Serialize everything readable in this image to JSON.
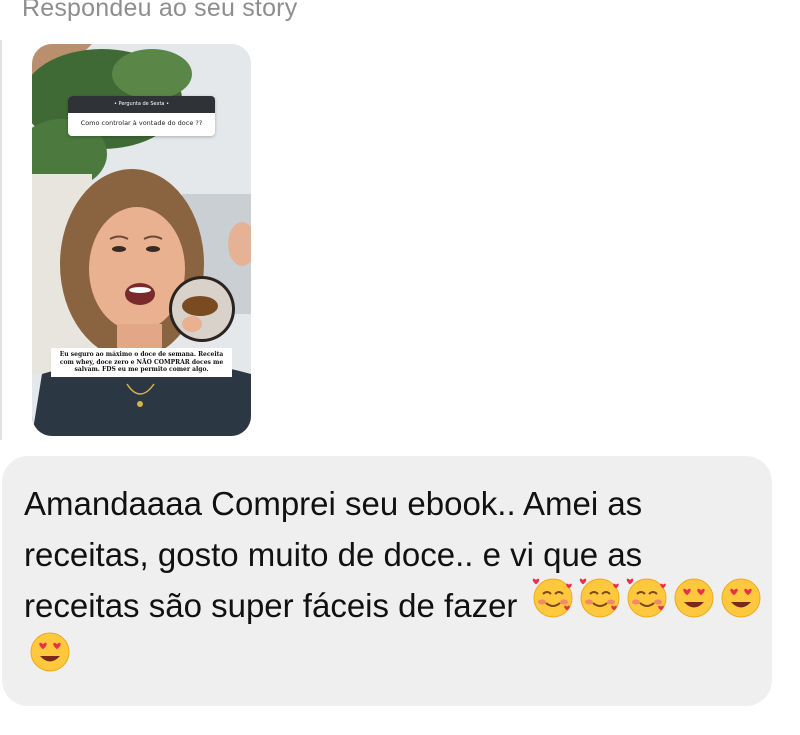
{
  "header": {
    "reply_label": "Respondeu ao seu story"
  },
  "story": {
    "question_header": "• Pergunta de Sexta •",
    "question_text": "Como controlar à vontade do doce ??",
    "answer_text": "Eu seguro ao máximo o doce de semana. Receita com whey, doce zero e NÃO COMPRAR doces me salvam. FDS eu me permito comer algo."
  },
  "message": {
    "text": "Amandaaaa Comprei seu ebook..  Amei as receitas, gosto muito de doce.. e vi que as receitas são super fáceis de fazer",
    "emojis": [
      "smiling-face-with-hearts",
      "smiling-face-with-hearts",
      "smiling-face-with-hearts",
      "heart-eyes",
      "heart-eyes",
      "heart-eyes"
    ]
  },
  "colors": {
    "bubble_bg": "#efefef",
    "label_gray": "#8e8e8e",
    "text": "#111111"
  }
}
